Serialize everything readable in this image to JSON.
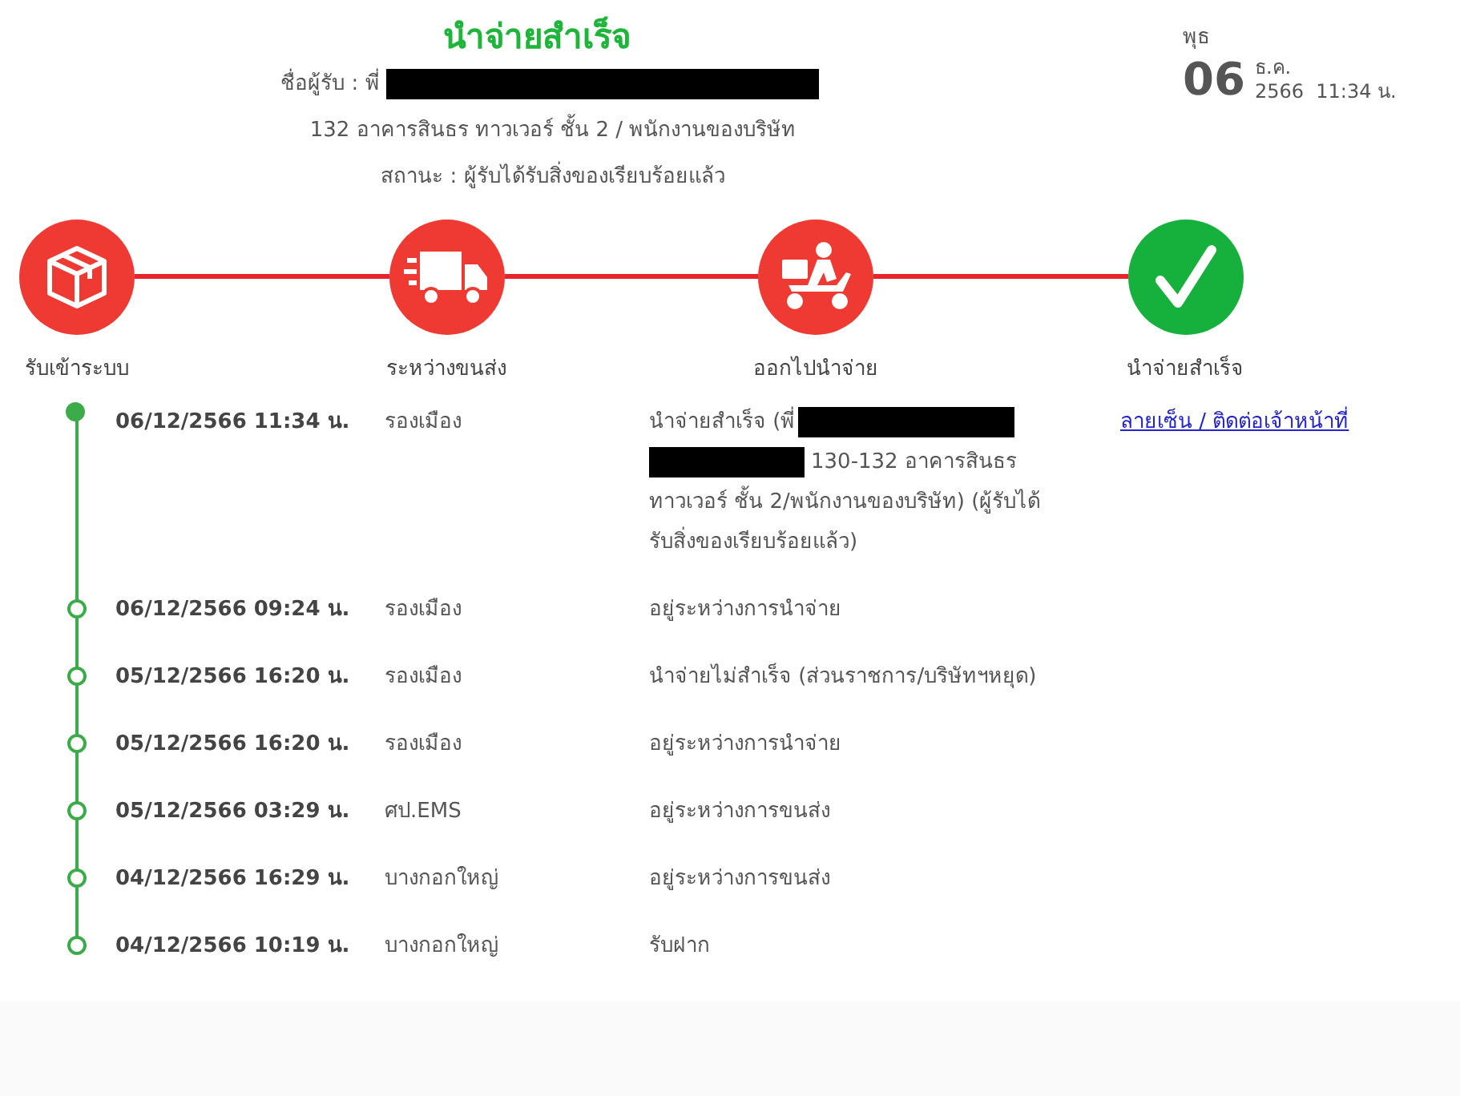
{
  "header": {
    "title": "นำจ่ายสำเร็จ",
    "recipient": {
      "label": "ชื่อผู้รับ : พี่",
      "redacted": true
    },
    "address": "132 อาคารสินธร ทาวเวอร์ ชั้น 2 / พนักงานของบริษัท",
    "status": "สถานะ : ผู้รับได้รับสิ่งของเรียบร้อยแล้ว"
  },
  "date": {
    "weekday": "พุธ",
    "day": "06",
    "month": "ธ.ค.",
    "year_time": "2566  11:34 น."
  },
  "steps": [
    {
      "kind": "box",
      "label": "รับเข้าระบบ",
      "color": "#ee3a32"
    },
    {
      "kind": "truck",
      "label": "ระหว่างขนส่ง",
      "color": "#ee3a32"
    },
    {
      "kind": "scooter",
      "label": "ออกไปนำจ่าย",
      "color": "#ee3a32"
    },
    {
      "kind": "check",
      "label": "นำจ่ายสำเร็จ",
      "color": "#16b03c"
    }
  ],
  "events": [
    {
      "current": true,
      "datetime": "06/12/2566 11:34 น.",
      "location": "รองเมือง",
      "description": [
        [
          {
            "kind": "text",
            "text": "นำจ่ายสำเร็จ (พี่"
          },
          {
            "kind": "redaction"
          }
        ],
        [
          {
            "kind": "redaction"
          },
          {
            "kind": "text",
            "text": "130-132 อาคารสินธร"
          }
        ],
        [
          {
            "kind": "text",
            "text": "ทาวเวอร์ ชั้น 2/พนักงานของบริษัท) (ผู้รับได้"
          }
        ],
        [
          {
            "kind": "text",
            "text": "รับสิ่งของเรียบร้อยแล้ว)"
          }
        ]
      ],
      "link": "ลายเซ็น / ติดต่อเจ้าหน้าที่"
    },
    {
      "current": false,
      "datetime": "06/12/2566 09:24 น.",
      "location": "รองเมือง",
      "description": [
        [
          {
            "kind": "text",
            "text": "อยู่ระหว่างการนำจ่าย"
          }
        ]
      ]
    },
    {
      "current": false,
      "datetime": "05/12/2566 16:20 น.",
      "location": "รองเมือง",
      "description": [
        [
          {
            "kind": "text",
            "text": "นำจ่ายไม่สำเร็จ (ส่วนราชการ/บริษัทฯหยุด)"
          }
        ]
      ]
    },
    {
      "current": false,
      "datetime": "05/12/2566 16:20 น.",
      "location": "รองเมือง",
      "description": [
        [
          {
            "kind": "text",
            "text": "อยู่ระหว่างการนำจ่าย"
          }
        ]
      ]
    },
    {
      "current": false,
      "datetime": "05/12/2566 03:29 น.",
      "location": "ศป.EMS",
      "description": [
        [
          {
            "kind": "text",
            "text": "อยู่ระหว่างการขนส่ง"
          }
        ]
      ]
    },
    {
      "current": false,
      "datetime": "04/12/2566 16:29 น.",
      "location": "บางกอกใหญ่",
      "description": [
        [
          {
            "kind": "text",
            "text": "อยู่ระหว่างการขนส่ง"
          }
        ]
      ]
    },
    {
      "current": false,
      "datetime": "04/12/2566 10:19 น.",
      "location": "บางกอกใหญ่",
      "description": [
        [
          {
            "kind": "text",
            "text": "รับฝาก"
          }
        ]
      ]
    }
  ]
}
